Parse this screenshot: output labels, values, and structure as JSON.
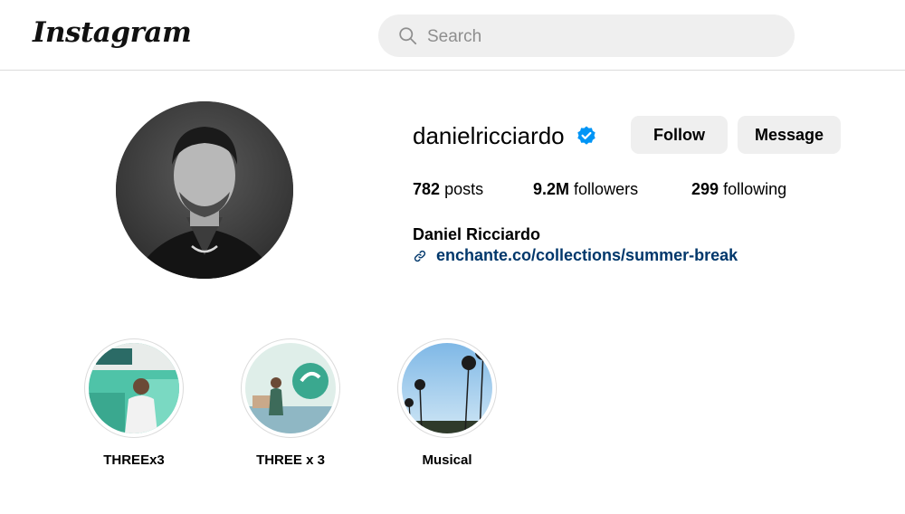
{
  "header": {
    "logo_text": "Instagram",
    "search": {
      "placeholder": "Search",
      "value": ""
    }
  },
  "profile": {
    "username": "danielricciardo",
    "verified": true,
    "follow_label": "Follow",
    "message_label": "Message",
    "stats": {
      "posts_count": "782",
      "posts_label": "posts",
      "followers_count": "9.2M",
      "followers_label": "followers",
      "following_count": "299",
      "following_label": "following"
    },
    "full_name": "Daniel Ricciardo",
    "link": "enchante.co/collections/summer-break"
  },
  "highlights": [
    {
      "label": "THREEx3"
    },
    {
      "label": "THREE x 3"
    },
    {
      "label": "Musical"
    }
  ],
  "icons": {
    "search": "search-icon",
    "verified": "verified-badge-icon",
    "link": "link-icon"
  },
  "colors": {
    "verified_blue": "#0095f6",
    "link_text": "#00376b",
    "button_bg": "#efefef",
    "search_bg": "#efefef",
    "divider": "#dbdbdb"
  }
}
